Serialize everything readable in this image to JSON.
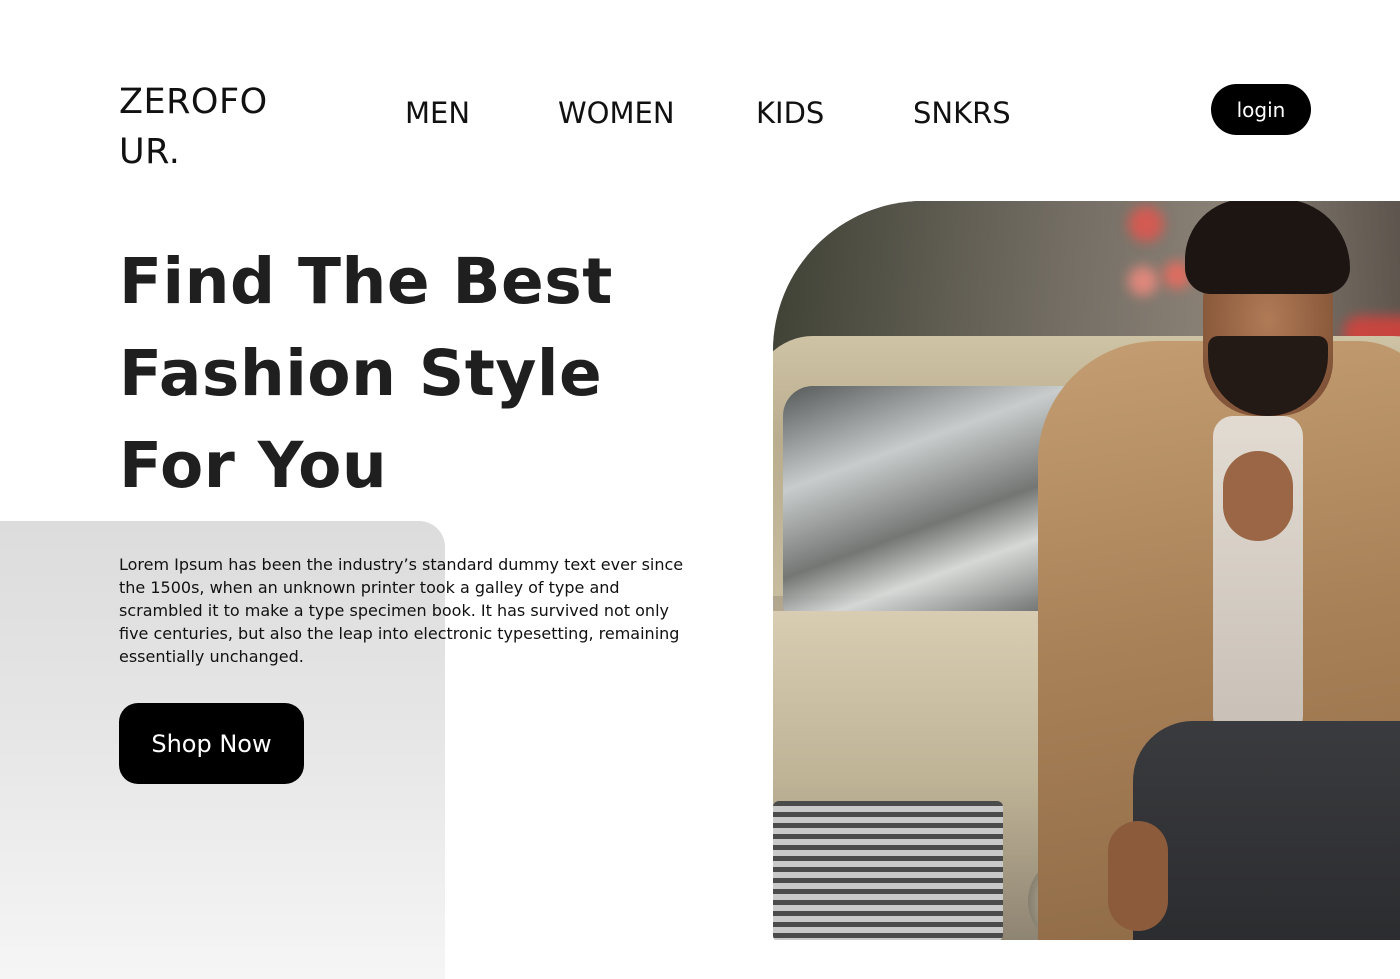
{
  "header": {
    "logo": "ZEROFOUR.",
    "nav": [
      {
        "label": "MEN"
      },
      {
        "label": "WOMEN"
      },
      {
        "label": "KIDS"
      },
      {
        "label": "SNKRS"
      }
    ],
    "login_label": "login"
  },
  "hero": {
    "title_lines": [
      "Find The Best",
      "Fashion Style",
      "For You"
    ],
    "description": "Lorem Ipsum has been the industry’s standard dummy text ever since the 1500s, when an unknown printer took a galley of type and scrambled it to make a type specimen book. It has survived not only five centuries, but also the leap into electronic typesetting, remaining essentially unchanged.",
    "cta_label": "Shop Now",
    "image_alt": "Man in a tan trench coat leaning on a vintage car"
  },
  "colors": {
    "accent": "#000000",
    "text": "#1f1f1f",
    "panel": "#e0e0e0",
    "background": "#ffffff"
  }
}
